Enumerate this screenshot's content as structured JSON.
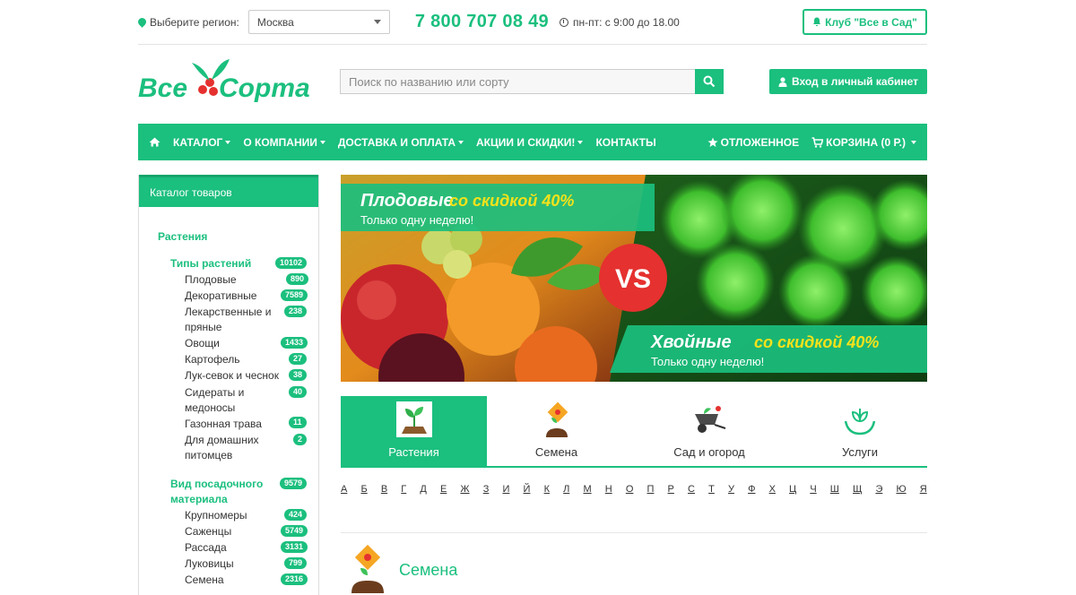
{
  "topbar": {
    "region_label": "Выберите регион:",
    "region_value": "Москва",
    "phone": "7 800 707 08 49",
    "hours": "пн-пт: с 9:00 до 18.00",
    "club_label": "Клуб \"Все в Сад\""
  },
  "header": {
    "logo_text_left": "Все",
    "logo_text_right": "Сорта",
    "search_placeholder": "Поиск по названию или сорту",
    "login_label": "Вход в личный кабинет"
  },
  "nav": {
    "items": [
      "КАТАЛОГ",
      "О КОМПАНИИ",
      "ДОСТАВКА И ОПЛАТА",
      "АКЦИИ И СКИДКИ!",
      "КОНТАКТЫ"
    ],
    "deferred": "ОТЛОЖЕННОЕ",
    "cart": "КОРЗИНА (0 Р.)"
  },
  "sidebar": {
    "title": "Каталог товаров",
    "section": "Растения",
    "group1": {
      "label": "Типы растений",
      "count": "10102"
    },
    "items1": [
      {
        "label": "Плодовые",
        "count": "890"
      },
      {
        "label": "Декоративные",
        "count": "7589"
      },
      {
        "label": "Лекарственные и пряные",
        "count": "238"
      },
      {
        "label": "Овощи",
        "count": "1433"
      },
      {
        "label": "Картофель",
        "count": "27"
      },
      {
        "label": "Лук-севок и чеснок",
        "count": "38"
      },
      {
        "label": "Сидераты и медоносы",
        "count": "40"
      },
      {
        "label": "Газонная трава",
        "count": "11"
      },
      {
        "label": "Для домашних питомцев",
        "count": "2"
      }
    ],
    "group2": {
      "label": "Вид посадочного материала",
      "count": "9579"
    },
    "items2": [
      {
        "label": "Крупномеры",
        "count": "424"
      },
      {
        "label": "Саженцы",
        "count": "5749"
      },
      {
        "label": "Рассада",
        "count": "3131"
      },
      {
        "label": "Луковицы",
        "count": "799"
      },
      {
        "label": "Семена",
        "count": "2316"
      }
    ]
  },
  "banner": {
    "left_title_a": "Плодовые",
    "left_title_b": "со скидкой 40%",
    "left_sub": "Только одну неделю!",
    "vs": "VS",
    "right_title_a": "Хвойные",
    "right_title_b": "со скидкой 40%",
    "right_sub": "Только одну неделю!"
  },
  "categories": [
    "Растения",
    "Семена",
    "Сад и огород",
    "Услуги"
  ],
  "alphabet": [
    "А",
    "Б",
    "В",
    "Г",
    "Д",
    "Е",
    "Ж",
    "З",
    "И",
    "Й",
    "К",
    "Л",
    "М",
    "Н",
    "О",
    "П",
    "Р",
    "С",
    "Т",
    "У",
    "Ф",
    "Х",
    "Ц",
    "Ч",
    "Ш",
    "Щ",
    "Э",
    "Ю",
    "Я"
  ],
  "section_title": "Семена",
  "colors": {
    "brand": "#1bbf7e",
    "accent_red": "#e5312f",
    "yellow": "#f5e21a"
  }
}
